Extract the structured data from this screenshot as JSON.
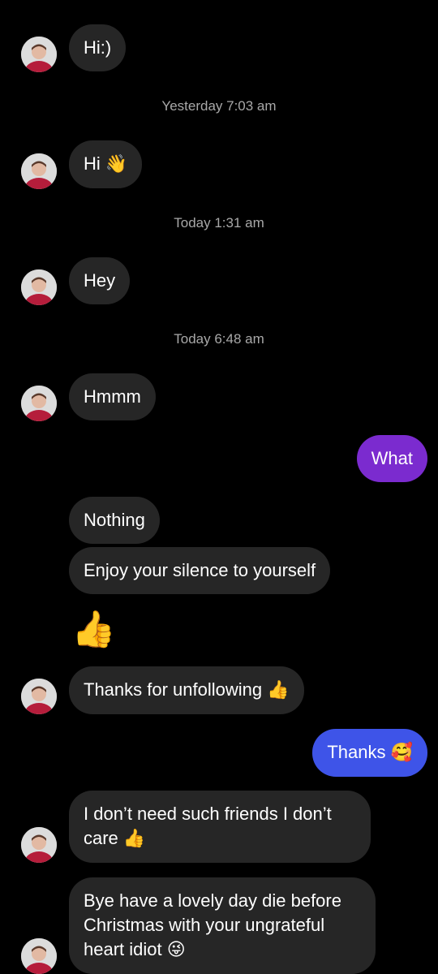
{
  "conversation": {
    "messages": [
      {
        "from": "them",
        "text": "Hi:)"
      },
      {
        "timestamp": "Yesterday 7:03 am"
      },
      {
        "from": "them",
        "text": "Hi",
        "emoji": "👋"
      },
      {
        "timestamp": "Today 1:31 am"
      },
      {
        "from": "them",
        "text": "Hey"
      },
      {
        "timestamp": "Today 6:48 am"
      },
      {
        "from": "them",
        "text": "Hmmm"
      },
      {
        "from": "me",
        "text": "What"
      },
      {
        "from": "them",
        "text": "Nothing"
      },
      {
        "from": "them",
        "text": "Enjoy your silence to yourself"
      },
      {
        "from": "them",
        "emoji": "👍"
      },
      {
        "from": "them",
        "text": "Thanks for unfollowing",
        "emoji": "👍"
      },
      {
        "from": "me",
        "text": "Thanks",
        "emoji": "🥰"
      },
      {
        "from": "them",
        "text": "I don’t need such friends I don’t care",
        "emoji": "👍"
      },
      {
        "from": "them",
        "text": "Bye have a lovely day die before Christmas with your ungrateful heart idiot",
        "emoji": "😜"
      }
    ]
  },
  "colors": {
    "background": "#000000",
    "received_bubble": "#262626",
    "sent_bubble_purple": "#7b2bcf",
    "sent_bubble_blue": "#3e54e8",
    "timestamp_text": "#a8a8a8"
  },
  "icons": {
    "avatar": "profile-photo-avatar"
  }
}
